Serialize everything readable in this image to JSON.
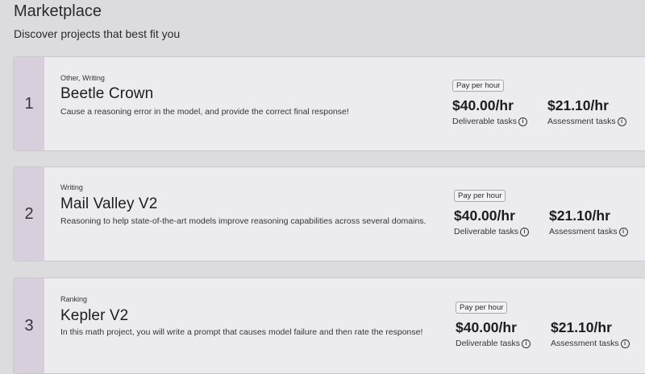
{
  "header": {
    "title": "Marketplace",
    "subtitle": "Discover projects that best fit you"
  },
  "info_icon_glyph": "i",
  "projects": [
    {
      "rank": "1",
      "categories": "Other, Writing",
      "name": "Beetle Crown",
      "description": "Cause a reasoning error in the model, and provide the correct final response!",
      "pay_type": "Pay per hour",
      "deliverable_rate": "$40.00/hr",
      "assessment_rate": "$21.10/hr",
      "deliverable_label": "Deliverable tasks",
      "assessment_label": "Assessment tasks"
    },
    {
      "rank": "2",
      "categories": "Writing",
      "name": "Mail Valley V2",
      "description": "Reasoning to help state-of-the-art models improve reasoning capabilities across several domains.",
      "pay_type": "Pay per hour",
      "deliverable_rate": "$40.00/hr",
      "assessment_rate": "$21.10/hr",
      "deliverable_label": "Deliverable tasks",
      "assessment_label": "Assessment tasks"
    },
    {
      "rank": "3",
      "categories": "Ranking",
      "name": "Kepler V2",
      "description": "In this math project, you will write a prompt that causes model failure and then rate the response!",
      "pay_type": "Pay per hour",
      "deliverable_rate": "$40.00/hr",
      "assessment_rate": "$21.10/hr",
      "deliverable_label": "Deliverable tasks",
      "assessment_label": "Assessment tasks"
    }
  ]
}
